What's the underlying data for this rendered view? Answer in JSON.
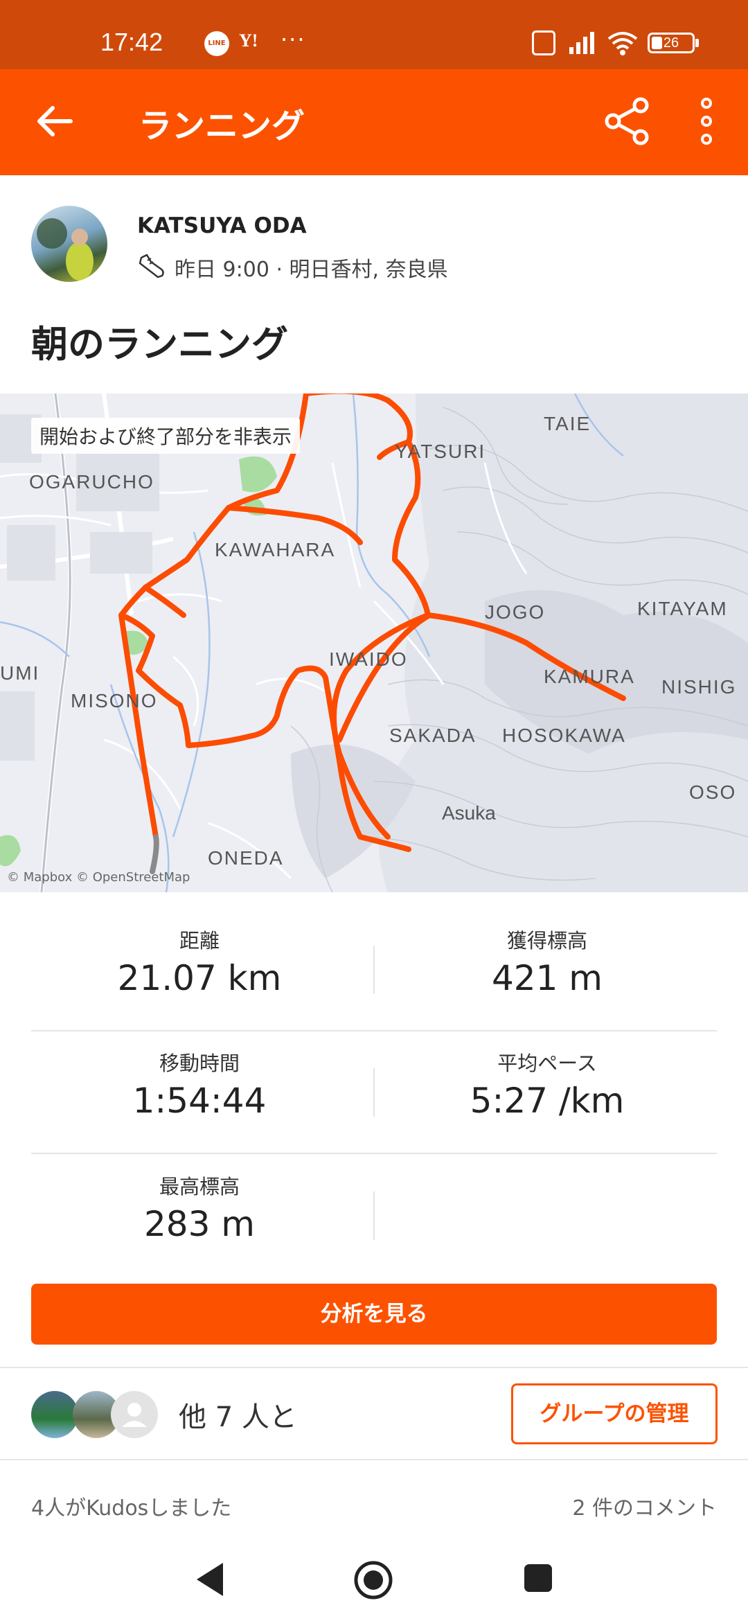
{
  "status_bar": {
    "time": "17:42",
    "line_label": "LINE",
    "yahoo_label": "Y!",
    "more_label": "···",
    "battery": "26",
    "battery_level": 0.26
  },
  "app_bar": {
    "title": "ランニング"
  },
  "athlete": {
    "name": "KATSUYA ODA",
    "meta": "昨日 9:00 · 明日香村, 奈良県"
  },
  "activity": {
    "title": "朝のランニング"
  },
  "map": {
    "hide_toggle": "開始および終了部分を非表示",
    "attribution": "© Mapbox © OpenStreetMap",
    "labels": [
      "TAIE",
      "YATSURI",
      "OGARUCHO",
      "KAWAHARA",
      "JOGO",
      "KITAYAM",
      "UMI",
      "IWAIDO",
      "KAMURA",
      "NISHIG",
      "MISONO",
      "SAKADA",
      "HOSOKAWA",
      "Asuka",
      "OSO",
      "ONEDA"
    ],
    "route_color": "#fc4c02"
  },
  "stats": [
    {
      "label": "距離",
      "value": "21.07 km"
    },
    {
      "label": "獲得標高",
      "value": "421 m"
    },
    {
      "label": "移動時間",
      "value": "1:54:44"
    },
    {
      "label": "平均ペース",
      "value": "5:27 /km"
    },
    {
      "label": "最高標高",
      "value": "283 m"
    }
  ],
  "analysis_button": "分析を見る",
  "group": {
    "text": "他 7 人と",
    "manage_button": "グループの管理"
  },
  "footer": {
    "kudos": "4人がKudosしました",
    "comments": "2 件のコメント"
  },
  "colors": {
    "brand": "#fc5200",
    "status_bar": "#cf4a0a"
  },
  "icons": [
    "back-arrow-icon",
    "share-icon",
    "more-vertical-icon",
    "shoe-icon",
    "nav-back-icon",
    "nav-home-icon",
    "nav-recent-icon"
  ]
}
